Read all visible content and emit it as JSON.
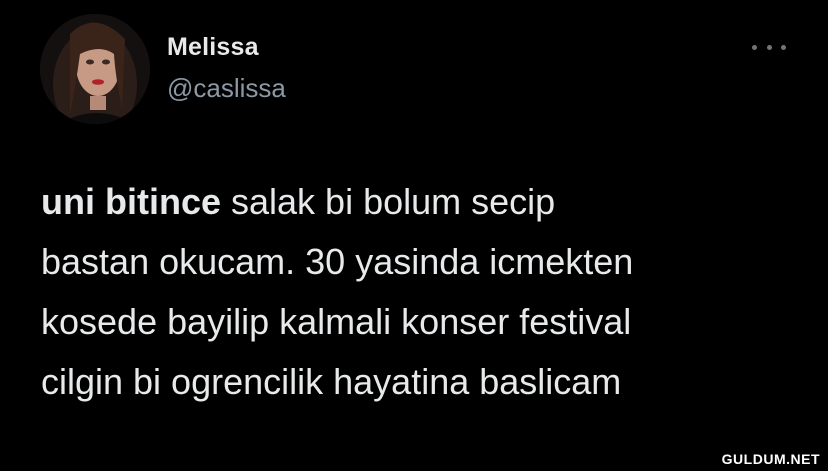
{
  "author": {
    "name": "Melissa",
    "handle": "@caslissa"
  },
  "tweet": {
    "highlight": "uni bitince",
    "lines": [
      " salak bi bolum secip",
      "bastan okucam. 30 yasinda icmekten",
      "kosede bayilip kalmali konser festival",
      "cilgin bi ogrencilik hayatina baslicam"
    ]
  },
  "icons": {
    "more": "more-options-icon"
  },
  "watermark": "GULDUM.NET",
  "colors": {
    "background": "#000000",
    "text": "#e7e9ea",
    "secondary": "#8b98a5"
  }
}
